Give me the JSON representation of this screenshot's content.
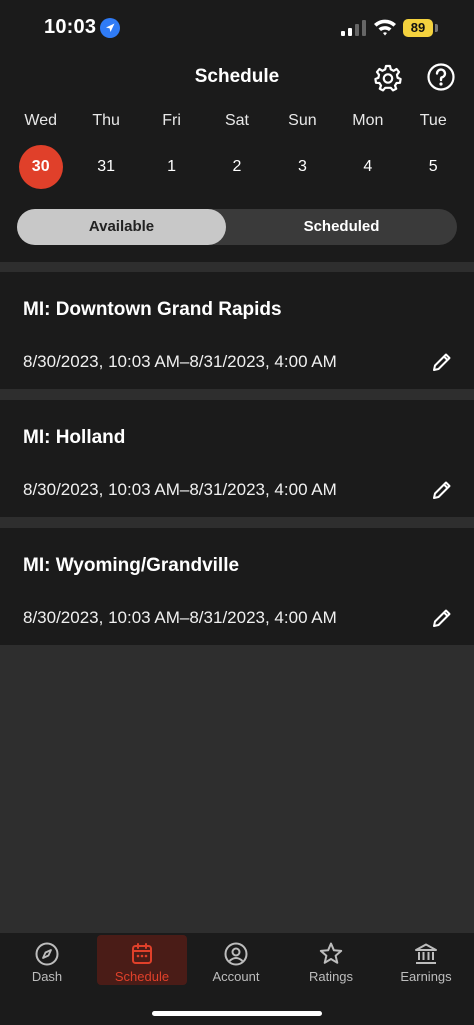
{
  "status": {
    "time": "10:03",
    "battery": "89"
  },
  "header": {
    "title": "Schedule"
  },
  "week": {
    "days": [
      "Wed",
      "Thu",
      "Fri",
      "Sat",
      "Sun",
      "Mon",
      "Tue"
    ],
    "dates": [
      "30",
      "31",
      "1",
      "2",
      "3",
      "4",
      "5"
    ],
    "selected_index": 0
  },
  "toggle": {
    "available": "Available",
    "scheduled": "Scheduled",
    "active": "available"
  },
  "slots": [
    {
      "location": "MI: Downtown Grand Rapids",
      "time": "8/30/2023, 10:03 AM–8/31/2023, 4:00 AM"
    },
    {
      "location": "MI: Holland",
      "time": "8/30/2023, 10:03 AM–8/31/2023, 4:00 AM"
    },
    {
      "location": "MI: Wyoming/Grandville",
      "time": "8/30/2023, 10:03 AM–8/31/2023, 4:00 AM"
    }
  ],
  "tabs": [
    {
      "label": "Dash",
      "icon": "compass-icon"
    },
    {
      "label": "Schedule",
      "icon": "calendar-icon",
      "active": true
    },
    {
      "label": "Account",
      "icon": "user-circle-icon"
    },
    {
      "label": "Ratings",
      "icon": "star-icon"
    },
    {
      "label": "Earnings",
      "icon": "bank-icon"
    }
  ],
  "colors": {
    "accent": "#e0402a",
    "background": "#1b1b1b",
    "battery": "#f4d23e"
  }
}
